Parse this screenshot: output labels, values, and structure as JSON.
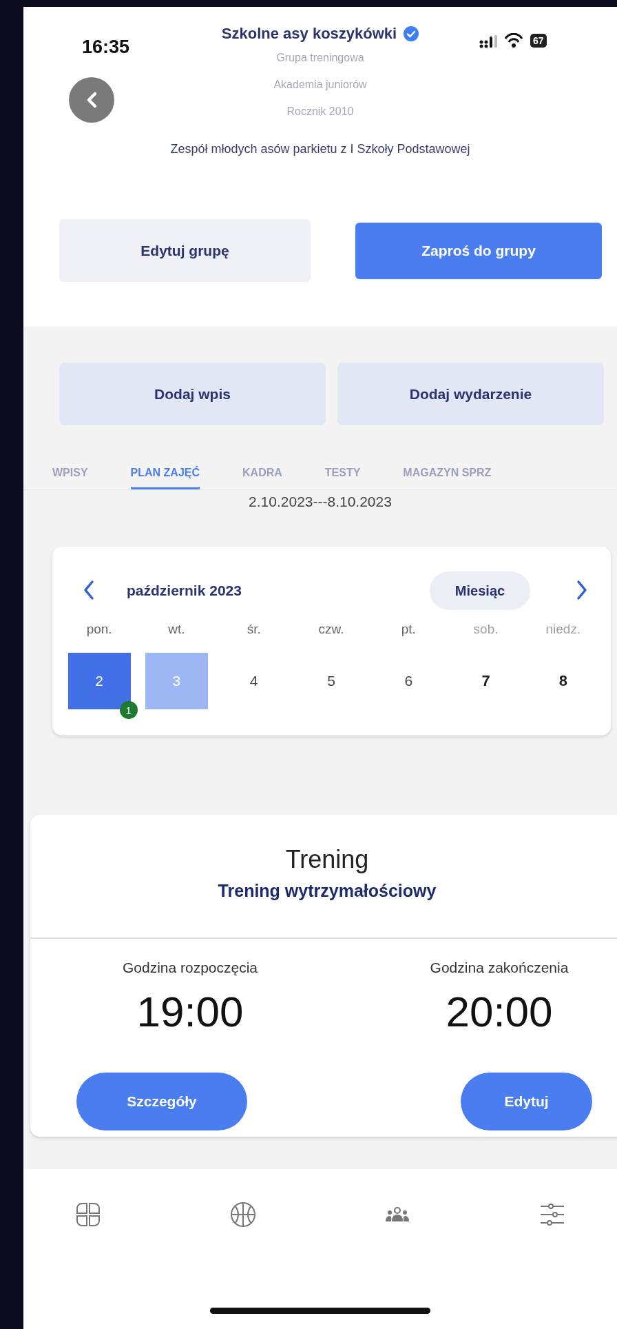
{
  "status_bar": {
    "time": "16:35",
    "battery": "67"
  },
  "header": {
    "title": "Szkolne asy koszykówki",
    "verified": true,
    "subtitles": [
      "Grupa treningowa",
      "Akademia juniorów",
      "Rocznik 2010"
    ],
    "description": "Zespół młodych asów parkietu z I Szkoły Podstawowej"
  },
  "group_actions": [
    {
      "label": "Edytuj grupę",
      "kind": "secondary"
    },
    {
      "label": "Zaproś do grupy",
      "kind": "primary"
    }
  ],
  "add_actions": [
    "Dodaj wpis",
    "Dodaj wydarzenie"
  ],
  "tabs": [
    {
      "label": "WPISY",
      "selected": false
    },
    {
      "label": "PLAN ZAJĘĆ",
      "selected": true
    },
    {
      "label": "KADRA",
      "selected": false
    },
    {
      "label": "TESTY",
      "selected": false
    },
    {
      "label": "MAGAZYN SPRZ",
      "selected": false
    }
  ],
  "date_range": "2.10.2023---8.10.2023",
  "calendar": {
    "month": "październik 2023",
    "view_button": "Miesiąc",
    "days": [
      {
        "weekday": "pon.",
        "day": "2",
        "selected": true,
        "highlighted": false,
        "weekend": false,
        "badge": "1"
      },
      {
        "weekday": "wt.",
        "day": "3",
        "selected": false,
        "highlighted": true,
        "weekend": false
      },
      {
        "weekday": "śr.",
        "day": "4",
        "selected": false,
        "highlighted": false,
        "weekend": false
      },
      {
        "weekday": "czw.",
        "day": "5",
        "selected": false,
        "highlighted": false,
        "weekend": false
      },
      {
        "weekday": "pt.",
        "day": "6",
        "selected": false,
        "highlighted": false,
        "weekend": false
      },
      {
        "weekday": "sob.",
        "day": "7",
        "selected": false,
        "highlighted": false,
        "weekend": true
      },
      {
        "weekday": "niedz.",
        "day": "8",
        "selected": false,
        "highlighted": false,
        "weekend": true
      }
    ]
  },
  "event": {
    "title": "Trening",
    "subtitle": "Trening wytrzymałościowy",
    "start": {
      "label": "Godzina rozpoczęcia",
      "time": "19:00"
    },
    "end": {
      "label": "Godzina zakończenia",
      "time": "20:00"
    },
    "buttons": [
      "Szczegóły",
      "Edytuj"
    ]
  },
  "bottom_nav": [
    {
      "kind": "grid"
    },
    {
      "kind": "basketball"
    },
    {
      "kind": "people"
    },
    {
      "kind": "sliders"
    }
  ]
}
